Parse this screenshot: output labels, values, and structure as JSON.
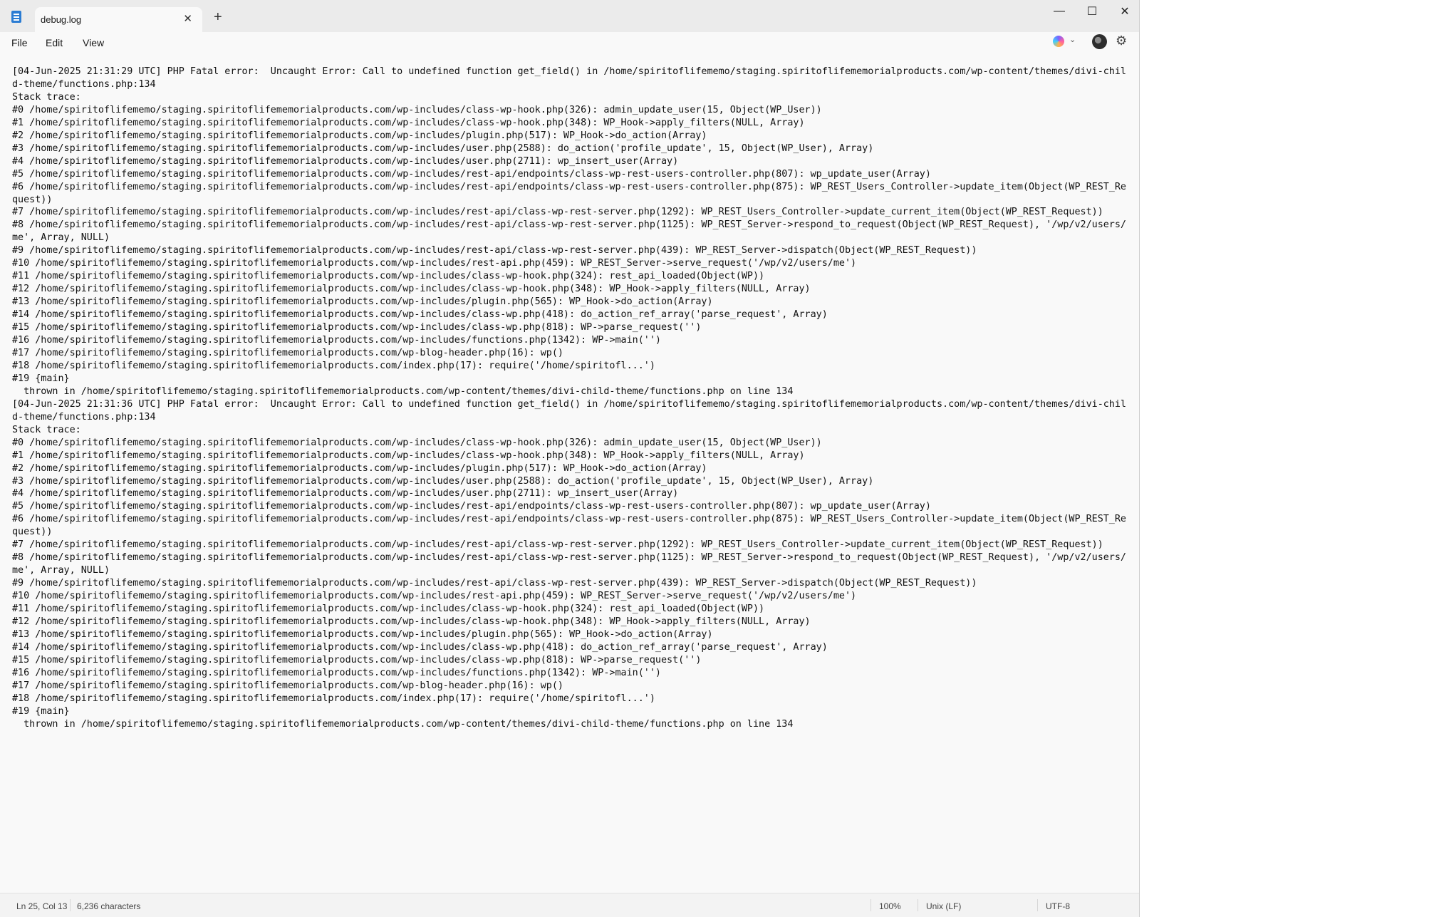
{
  "tab": {
    "title": "debug.log",
    "close_glyph": "✕",
    "new_tab_glyph": "+"
  },
  "window_controls": {
    "minimize": "—",
    "maximize": "☐",
    "close": "✕"
  },
  "menu": [
    "File",
    "Edit",
    "View"
  ],
  "toolbar_icons": [
    "copilot-icon",
    "chevron-down-icon",
    "avatar",
    "gear-icon"
  ],
  "settings_glyph": "⚙",
  "chevron_glyph": "⌄",
  "content": "[04-Jun-2025 21:31:29 UTC] PHP Fatal error:  Uncaught Error: Call to undefined function get_field() in /home/spiritoflifememo/staging.spiritoflifememorialproducts.com/wp-content/themes/divi-child-theme/functions.php:134\nStack trace:\n#0 /home/spiritoflifememo/staging.spiritoflifememorialproducts.com/wp-includes/class-wp-hook.php(326): admin_update_user(15, Object(WP_User))\n#1 /home/spiritoflifememo/staging.spiritoflifememorialproducts.com/wp-includes/class-wp-hook.php(348): WP_Hook->apply_filters(NULL, Array)\n#2 /home/spiritoflifememo/staging.spiritoflifememorialproducts.com/wp-includes/plugin.php(517): WP_Hook->do_action(Array)\n#3 /home/spiritoflifememo/staging.spiritoflifememorialproducts.com/wp-includes/user.php(2588): do_action('profile_update', 15, Object(WP_User), Array)\n#4 /home/spiritoflifememo/staging.spiritoflifememorialproducts.com/wp-includes/user.php(2711): wp_insert_user(Array)\n#5 /home/spiritoflifememo/staging.spiritoflifememorialproducts.com/wp-includes/rest-api/endpoints/class-wp-rest-users-controller.php(807): wp_update_user(Array)\n#6 /home/spiritoflifememo/staging.spiritoflifememorialproducts.com/wp-includes/rest-api/endpoints/class-wp-rest-users-controller.php(875): WP_REST_Users_Controller->update_item(Object(WP_REST_Request))\n#7 /home/spiritoflifememo/staging.spiritoflifememorialproducts.com/wp-includes/rest-api/class-wp-rest-server.php(1292): WP_REST_Users_Controller->update_current_item(Object(WP_REST_Request))\n#8 /home/spiritoflifememo/staging.spiritoflifememorialproducts.com/wp-includes/rest-api/class-wp-rest-server.php(1125): WP_REST_Server->respond_to_request(Object(WP_REST_Request), '/wp/v2/users/me', Array, NULL)\n#9 /home/spiritoflifememo/staging.spiritoflifememorialproducts.com/wp-includes/rest-api/class-wp-rest-server.php(439): WP_REST_Server->dispatch(Object(WP_REST_Request))\n#10 /home/spiritoflifememo/staging.spiritoflifememorialproducts.com/wp-includes/rest-api.php(459): WP_REST_Server->serve_request('/wp/v2/users/me')\n#11 /home/spiritoflifememo/staging.spiritoflifememorialproducts.com/wp-includes/class-wp-hook.php(324): rest_api_loaded(Object(WP))\n#12 /home/spiritoflifememo/staging.spiritoflifememorialproducts.com/wp-includes/class-wp-hook.php(348): WP_Hook->apply_filters(NULL, Array)\n#13 /home/spiritoflifememo/staging.spiritoflifememorialproducts.com/wp-includes/plugin.php(565): WP_Hook->do_action(Array)\n#14 /home/spiritoflifememo/staging.spiritoflifememorialproducts.com/wp-includes/class-wp.php(418): do_action_ref_array('parse_request', Array)\n#15 /home/spiritoflifememo/staging.spiritoflifememorialproducts.com/wp-includes/class-wp.php(818): WP->parse_request('')\n#16 /home/spiritoflifememo/staging.spiritoflifememorialproducts.com/wp-includes/functions.php(1342): WP->main('')\n#17 /home/spiritoflifememo/staging.spiritoflifememorialproducts.com/wp-blog-header.php(16): wp()\n#18 /home/spiritoflifememo/staging.spiritoflifememorialproducts.com/index.php(17): require('/home/spiritofl...')\n#19 {main}\n  thrown in /home/spiritoflifememo/staging.spiritoflifememorialproducts.com/wp-content/themes/divi-child-theme/functions.php on line 134\n[04-Jun-2025 21:31:36 UTC] PHP Fatal error:  Uncaught Error: Call to undefined function get_field() in /home/spiritoflifememo/staging.spiritoflifememorialproducts.com/wp-content/themes/divi-child-theme/functions.php:134\nStack trace:\n#0 /home/spiritoflifememo/staging.spiritoflifememorialproducts.com/wp-includes/class-wp-hook.php(326): admin_update_user(15, Object(WP_User))\n#1 /home/spiritoflifememo/staging.spiritoflifememorialproducts.com/wp-includes/class-wp-hook.php(348): WP_Hook->apply_filters(NULL, Array)\n#2 /home/spiritoflifememo/staging.spiritoflifememorialproducts.com/wp-includes/plugin.php(517): WP_Hook->do_action(Array)\n#3 /home/spiritoflifememo/staging.spiritoflifememorialproducts.com/wp-includes/user.php(2588): do_action('profile_update', 15, Object(WP_User), Array)\n#4 /home/spiritoflifememo/staging.spiritoflifememorialproducts.com/wp-includes/user.php(2711): wp_insert_user(Array)\n#5 /home/spiritoflifememo/staging.spiritoflifememorialproducts.com/wp-includes/rest-api/endpoints/class-wp-rest-users-controller.php(807): wp_update_user(Array)\n#6 /home/spiritoflifememo/staging.spiritoflifememorialproducts.com/wp-includes/rest-api/endpoints/class-wp-rest-users-controller.php(875): WP_REST_Users_Controller->update_item(Object(WP_REST_Request))\n#7 /home/spiritoflifememo/staging.spiritoflifememorialproducts.com/wp-includes/rest-api/class-wp-rest-server.php(1292): WP_REST_Users_Controller->update_current_item(Object(WP_REST_Request))\n#8 /home/spiritoflifememo/staging.spiritoflifememorialproducts.com/wp-includes/rest-api/class-wp-rest-server.php(1125): WP_REST_Server->respond_to_request(Object(WP_REST_Request), '/wp/v2/users/me', Array, NULL)\n#9 /home/spiritoflifememo/staging.spiritoflifememorialproducts.com/wp-includes/rest-api/class-wp-rest-server.php(439): WP_REST_Server->dispatch(Object(WP_REST_Request))\n#10 /home/spiritoflifememo/staging.spiritoflifememorialproducts.com/wp-includes/rest-api.php(459): WP_REST_Server->serve_request('/wp/v2/users/me')\n#11 /home/spiritoflifememo/staging.spiritoflifememorialproducts.com/wp-includes/class-wp-hook.php(324): rest_api_loaded(Object(WP))\n#12 /home/spiritoflifememo/staging.spiritoflifememorialproducts.com/wp-includes/class-wp-hook.php(348): WP_Hook->apply_filters(NULL, Array)\n#13 /home/spiritoflifememo/staging.spiritoflifememorialproducts.com/wp-includes/plugin.php(565): WP_Hook->do_action(Array)\n#14 /home/spiritoflifememo/staging.spiritoflifememorialproducts.com/wp-includes/class-wp.php(418): do_action_ref_array('parse_request', Array)\n#15 /home/spiritoflifememo/staging.spiritoflifememorialproducts.com/wp-includes/class-wp.php(818): WP->parse_request('')\n#16 /home/spiritoflifememo/staging.spiritoflifememorialproducts.com/wp-includes/functions.php(1342): WP->main('')\n#17 /home/spiritoflifememo/staging.spiritoflifememorialproducts.com/wp-blog-header.php(16): wp()\n#18 /home/spiritoflifememo/staging.spiritoflifememorialproducts.com/index.php(17): require('/home/spiritofl...')\n#19 {main}\n  thrown in /home/spiritoflifememo/staging.spiritoflifememorialproducts.com/wp-content/themes/divi-child-theme/functions.php on line 134",
  "status": {
    "position": "Ln 25, Col 13",
    "characters": "6,236 characters",
    "zoom": "100%",
    "line_endings": "Unix (LF)",
    "encoding": "UTF-8"
  }
}
